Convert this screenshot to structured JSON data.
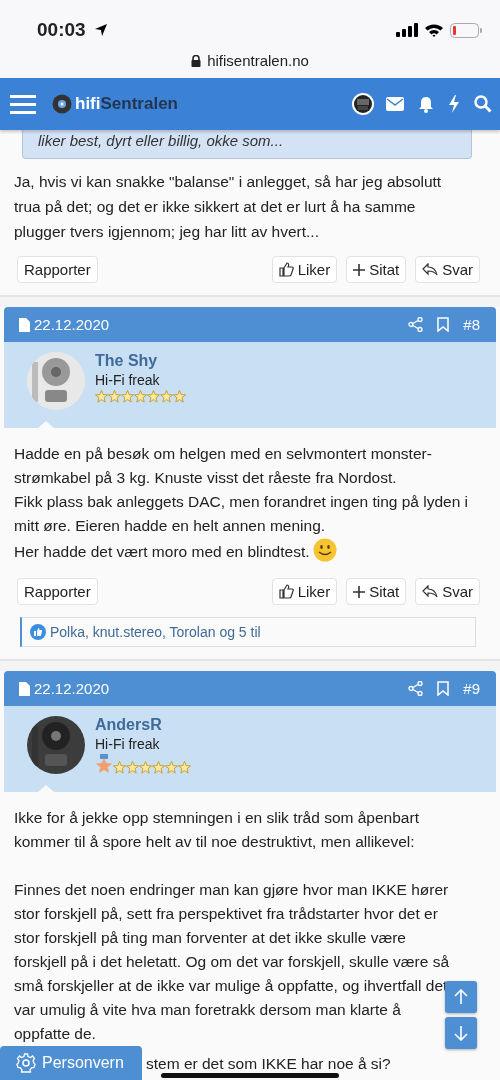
{
  "status_bar": {
    "time": "00:03",
    "url": "hifisentralen.no"
  },
  "header": {
    "logo_part_1": "hifi",
    "logo_part_2": "Sentralen"
  },
  "previous_post": {
    "quote": "liker best, dyrt eller billig, okke som...",
    "body": "Ja, hvis vi kan snakke \"balanse\" i anlegget, så har jeg absolutt trua på det; og det er ikke sikkert at det er lurt å ha samme plugger tvers igjennom; jeg har litt av hvert...",
    "actions": {
      "report": "Rapporter",
      "like": "Liker",
      "quote": "Sitat",
      "reply": "Svar"
    }
  },
  "posts": [
    {
      "date": "22.12.2020",
      "number": "#8",
      "author": "The Shy",
      "rank": "Hi-Fi freak",
      "medal": false,
      "stars": 7,
      "paragraphs": [
        {
          "text": "Hadde en på besøk om helgen med en selvmontert monster-strømkabel på 3 kg. Knuste visst det råeste fra Nordost.",
          "smiley": false
        },
        {
          "text": "Fikk plass bak anleggets DAC, men forandret ingen ting på lyden i mitt øre. Eieren hadde en helt annen mening.",
          "smiley": false
        },
        {
          "text": "Her hadde det vært moro med en blindtest.",
          "smiley": true
        }
      ],
      "actions": {
        "report": "Rapporter",
        "like": "Liker",
        "quote": "Sitat",
        "reply": "Svar"
      },
      "reactions": "Polka, knut.stereo, Torolan og 5 til"
    },
    {
      "date": "22.12.2020",
      "number": "#9",
      "author": "AndersR",
      "rank": "Hi-Fi freak",
      "medal": true,
      "stars": 6,
      "paragraphs": [
        {
          "text": "Ikke for å jekke opp stemningen i en slik tråd som åpenbart kommer til å spore helt av til noe destruktivt, men allikevel:",
          "smiley": false
        },
        {
          "text": "Finnes det noen endringer man kan gjøre hvor man IKKE hører stor forskjell på, sett fra perspektivet fra trådstarter hvor det er stor forskjell på ting man forventer at det ikke skulle være forskjell på i det heletatt. Og om det var forskjell, skulle være så små forskjeller at de ikke var mulige å oppfatte, og ihvertfall det var umulig å vite hva man foretrakk dersom man klarte å oppfatte de.",
          "smiley": false
        }
      ],
      "trailing": "stem er det som IKKE har noe å si?"
    }
  ],
  "privacy_button": "Personvern"
}
